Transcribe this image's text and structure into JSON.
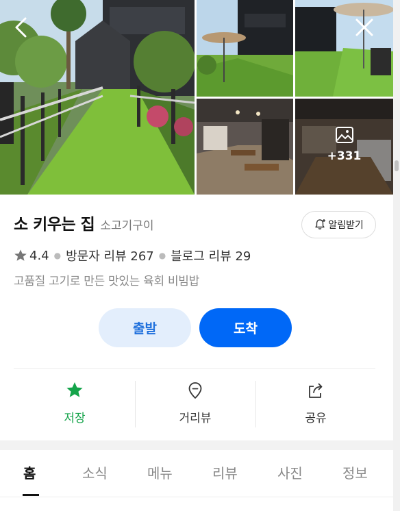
{
  "gallery": {
    "photos": [
      "main-photo",
      "photo-2",
      "photo-3",
      "photo-4",
      "photo-5"
    ],
    "more_count": "+331"
  },
  "place": {
    "name": "소 키우는 집",
    "category": "소고기구이",
    "notify_label": "알림받기",
    "rating": "4.4",
    "visitor_reviews": "방문자 리뷰 267",
    "blog_reviews": "블로그 리뷰 29",
    "description": "고품질 고기로 만든 맛있는 육회 비빔밥"
  },
  "route": {
    "depart_label": "출발",
    "arrive_label": "도착"
  },
  "actions": {
    "save_label": "저장",
    "street_label": "거리뷰",
    "share_label": "공유"
  },
  "tabs": [
    {
      "label": "홈",
      "active": true
    },
    {
      "label": "소식"
    },
    {
      "label": "메뉴"
    },
    {
      "label": "리뷰"
    },
    {
      "label": "사진"
    },
    {
      "label": "정보"
    }
  ],
  "colors": {
    "accent_blue": "#0068f7",
    "light_blue": "#e3eefc",
    "save_green": "#14a44a",
    "star_gray": "#777777"
  },
  "icons": [
    "back-arrow-icon",
    "close-icon",
    "image-icon",
    "bell-plus-icon",
    "star-icon",
    "map-pin-icon",
    "share-icon"
  ]
}
